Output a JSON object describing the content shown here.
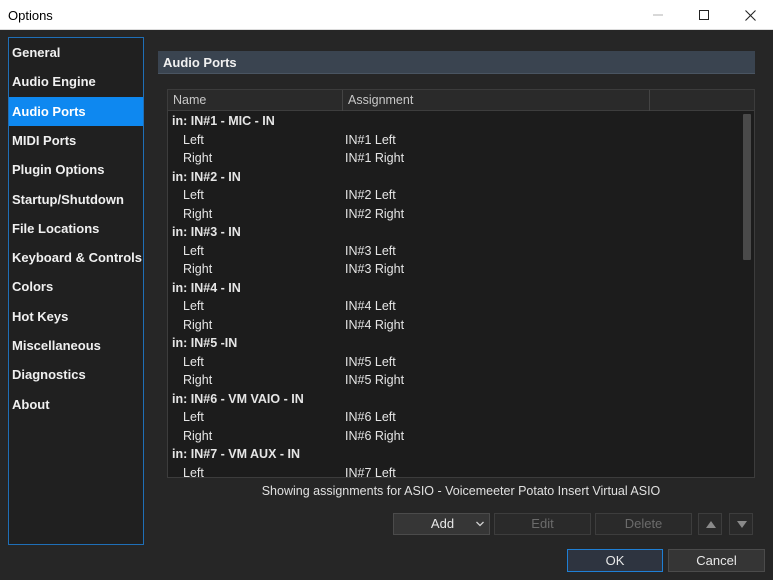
{
  "window": {
    "title": "Options"
  },
  "sidebar": {
    "items": [
      {
        "label": "General",
        "active": false
      },
      {
        "label": "Audio Engine",
        "active": false
      },
      {
        "label": "Audio Ports",
        "active": true
      },
      {
        "label": "MIDI Ports",
        "active": false
      },
      {
        "label": "Plugin Options",
        "active": false
      },
      {
        "label": "Startup/Shutdown",
        "active": false
      },
      {
        "label": "File Locations",
        "active": false
      },
      {
        "label": "Keyboard & Controls",
        "active": false
      },
      {
        "label": "Colors",
        "active": false
      },
      {
        "label": "Hot Keys",
        "active": false
      },
      {
        "label": "Miscellaneous",
        "active": false
      },
      {
        "label": "Diagnostics",
        "active": false
      },
      {
        "label": "About",
        "active": false
      }
    ]
  },
  "panel": {
    "title": "Audio Ports"
  },
  "table": {
    "columns": [
      "Name",
      "Assignment",
      ""
    ],
    "rows": [
      {
        "type": "group",
        "name": "in: IN#1 - MIC - IN",
        "assignment": ""
      },
      {
        "type": "sub",
        "name": "Left",
        "assignment": "IN#1 Left"
      },
      {
        "type": "sub",
        "name": "Right",
        "assignment": "IN#1 Right"
      },
      {
        "type": "group",
        "name": "in: IN#2 - IN",
        "assignment": ""
      },
      {
        "type": "sub",
        "name": "Left",
        "assignment": "IN#2 Left"
      },
      {
        "type": "sub",
        "name": "Right",
        "assignment": "IN#2 Right"
      },
      {
        "type": "group",
        "name": "in: IN#3 - IN",
        "assignment": ""
      },
      {
        "type": "sub",
        "name": "Left",
        "assignment": "IN#3 Left"
      },
      {
        "type": "sub",
        "name": "Right",
        "assignment": "IN#3 Right"
      },
      {
        "type": "group",
        "name": "in: IN#4 - IN",
        "assignment": ""
      },
      {
        "type": "sub",
        "name": "Left",
        "assignment": "IN#4 Left"
      },
      {
        "type": "sub",
        "name": "Right",
        "assignment": "IN#4 Right"
      },
      {
        "type": "group",
        "name": "in: IN#5 -IN",
        "assignment": ""
      },
      {
        "type": "sub",
        "name": "Left",
        "assignment": "IN#5 Left"
      },
      {
        "type": "sub",
        "name": "Right",
        "assignment": "IN#5 Right"
      },
      {
        "type": "group",
        "name": "in: IN#6 - VM VAIO - IN",
        "assignment": ""
      },
      {
        "type": "sub",
        "name": "Left",
        "assignment": "IN#6 Left"
      },
      {
        "type": "sub",
        "name": "Right",
        "assignment": "IN#6 Right"
      },
      {
        "type": "group",
        "name": "in: IN#7 - VM AUX - IN",
        "assignment": ""
      },
      {
        "type": "sub",
        "name": "Left",
        "assignment": "IN#7 Left"
      }
    ]
  },
  "status_text": "Showing assignments for ASIO - Voicemeeter Potato Insert Virtual ASIO",
  "buttons": {
    "add": "Add",
    "edit": "Edit",
    "delete": "Delete",
    "ok": "OK",
    "cancel": "Cancel"
  },
  "icons": {
    "minimize": "minimize-icon",
    "maximize": "maximize-icon",
    "close": "close-icon",
    "dropdown": "chevron-down-icon",
    "move_up": "triangle-up-icon",
    "move_down": "triangle-down-icon"
  },
  "colors": {
    "accent": "#0e88f0",
    "background": "#262626",
    "list_background": "#1c1c1c"
  }
}
